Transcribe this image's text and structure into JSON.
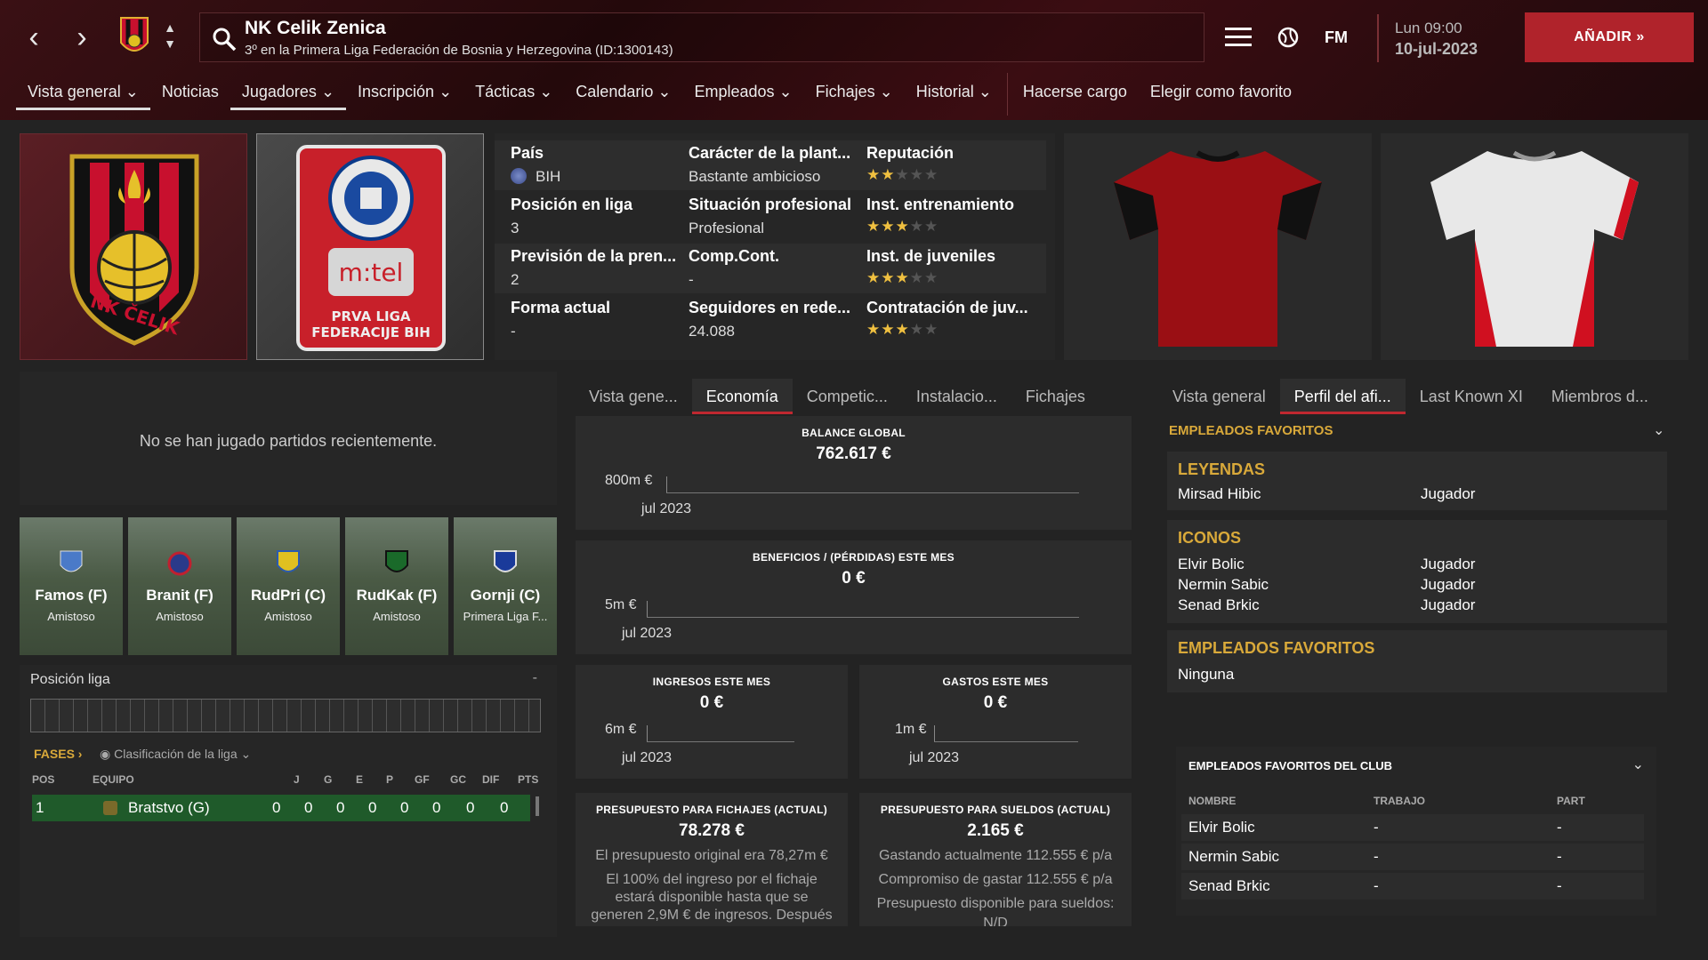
{
  "header": {
    "club_name": "NK Celik Zenica",
    "subtitle": "3º en la Primera Liga Federación de Bosnia y Herzegovina (ID:1300143)",
    "fm_label": "FM",
    "day_time": "Lun 09:00",
    "date": "10-jul-2023",
    "add_label": "AÑADIR"
  },
  "menu": [
    "Vista general",
    "Noticias",
    "Jugadores",
    "Inscripción",
    "Tácticas",
    "Calendario",
    "Empleados",
    "Fichajes",
    "Historial",
    "Hacerse cargo",
    "Elegir como favorito"
  ],
  "league_card": {
    "sponsor": "m:tel",
    "line1": "PRVA LIGA",
    "line2": "FEDERACIJE BIH"
  },
  "club_crest": {
    "text": "NK ČELIK"
  },
  "info": {
    "pais_label": "País",
    "pais_value": "BIH",
    "caracter_label": "Carácter de la plant...",
    "caracter_value": "Bastante ambicioso",
    "reputacion_label": "Reputación",
    "reputacion_stars": 1.5,
    "posicion_label": "Posición en liga",
    "posicion_value": "3",
    "situacion_label": "Situación profesional",
    "situacion_value": "Profesional",
    "entrenamiento_label": "Inst. entrenamiento",
    "entrenamiento_stars": 2.5,
    "prevision_label": "Previsión de la pren...",
    "prevision_value": "2",
    "compcont_label": "Comp.Cont.",
    "compcont_value": "-",
    "juveniles_label": "Inst. de juveniles",
    "juveniles_stars": 2.5,
    "forma_label": "Forma actual",
    "forma_value": "-",
    "seguidores_label": "Seguidores en rede...",
    "seguidores_value": "24.088",
    "contratacion_label": "Contratación de juv...",
    "contratacion_stars": 2.5
  },
  "recent": {
    "empty_msg": "No se han jugado partidos recientemente."
  },
  "fixtures": [
    {
      "name": "Famos (F)",
      "type": "Amistoso"
    },
    {
      "name": "Branit (F)",
      "type": "Amistoso"
    },
    {
      "name": "RudPri (C)",
      "type": "Amistoso"
    },
    {
      "name": "RudKak (F)",
      "type": "Amistoso"
    },
    {
      "name": "Gornji (C)",
      "type": "Primera Liga F..."
    }
  ],
  "league_pos": {
    "title": "Posición liga",
    "dash": "-",
    "fases": "FASES",
    "clasif": "Clasificación de la liga"
  },
  "table": {
    "headers": [
      "POS",
      "EQUIPO",
      "J",
      "G",
      "E",
      "P",
      "GF",
      "GC",
      "DIF",
      "PTS"
    ],
    "row": {
      "pos": "1",
      "team": "Bratstvo (G)",
      "j": "0",
      "g": "0",
      "e": "0",
      "p": "0",
      "gf": "0",
      "gc": "0",
      "dif": "0",
      "pts": "0"
    }
  },
  "mid_tabs": [
    "Vista gene...",
    "Economía",
    "Competic...",
    "Instalacio...",
    "Fichajes"
  ],
  "finance": {
    "balance": {
      "title": "BALANCE GLOBAL",
      "value": "762.617 €",
      "axis": "800m €",
      "period": "jul 2023"
    },
    "profit": {
      "title": "BENEFICIOS / (PÉRDIDAS) ESTE MES",
      "value": "0 €",
      "axis": "5m €",
      "period": "jul 2023"
    },
    "income": {
      "title": "INGRESOS ESTE MES",
      "value": "0 €",
      "axis": "6m €",
      "period": "jul 2023"
    },
    "expenses": {
      "title": "GASTOS ESTE MES",
      "value": "0 €",
      "axis": "1m €",
      "period": "jul 2023"
    },
    "transfer": {
      "title": "PRESUPUESTO PARA FICHAJES (ACTUAL)",
      "value": "78.278 €",
      "note1": "El presupuesto original era 78,27m €",
      "note2": "El 100% del ingreso por el fichaje",
      "note3": "estará disponible hasta que se",
      "note4": "generen 2,9M € de ingresos. Después"
    },
    "wages": {
      "title": "PRESUPUESTO PARA SUELDOS (ACTUAL)",
      "value": "2.165 €",
      "note1": "Gastando actualmente 112.555 € p/a",
      "note2": "Compromiso de gastar 112.555 € p/a",
      "note3": "Presupuesto disponible para sueldos:",
      "note4": "N/D"
    }
  },
  "right_tabs": [
    "Vista general",
    "Perfil del afi...",
    "Last Known XI",
    "Miembros d..."
  ],
  "favorites": {
    "section_title": "EMPLEADOS FAVORITOS",
    "leyendas_title": "LEYENDAS",
    "leyendas": [
      {
        "name": "Mirsad Hibic",
        "role": "Jugador"
      }
    ],
    "iconos_title": "ICONOS",
    "iconos": [
      {
        "name": "Elvir Bolic",
        "role": "Jugador"
      },
      {
        "name": "Nermin Sabic",
        "role": "Jugador"
      },
      {
        "name": "Senad Brkic",
        "role": "Jugador"
      }
    ],
    "empleados_title": "EMPLEADOS FAVORITOS",
    "empleados_value": "Ninguna"
  },
  "club_staff": {
    "title": "EMPLEADOS FAVORITOS DEL CLUB",
    "headers": [
      "NOMBRE",
      "TRABAJO",
      "PART"
    ],
    "rows": [
      {
        "name": "Elvir Bolic",
        "job": "-",
        "part": "-"
      },
      {
        "name": "Nermin Sabic",
        "job": "-",
        "part": "-"
      },
      {
        "name": "Senad Brkic",
        "job": "-",
        "part": "-"
      }
    ]
  },
  "colors": {
    "accent": "#b0232b",
    "gold": "#d9a93a",
    "active_tab": "#c02830"
  }
}
